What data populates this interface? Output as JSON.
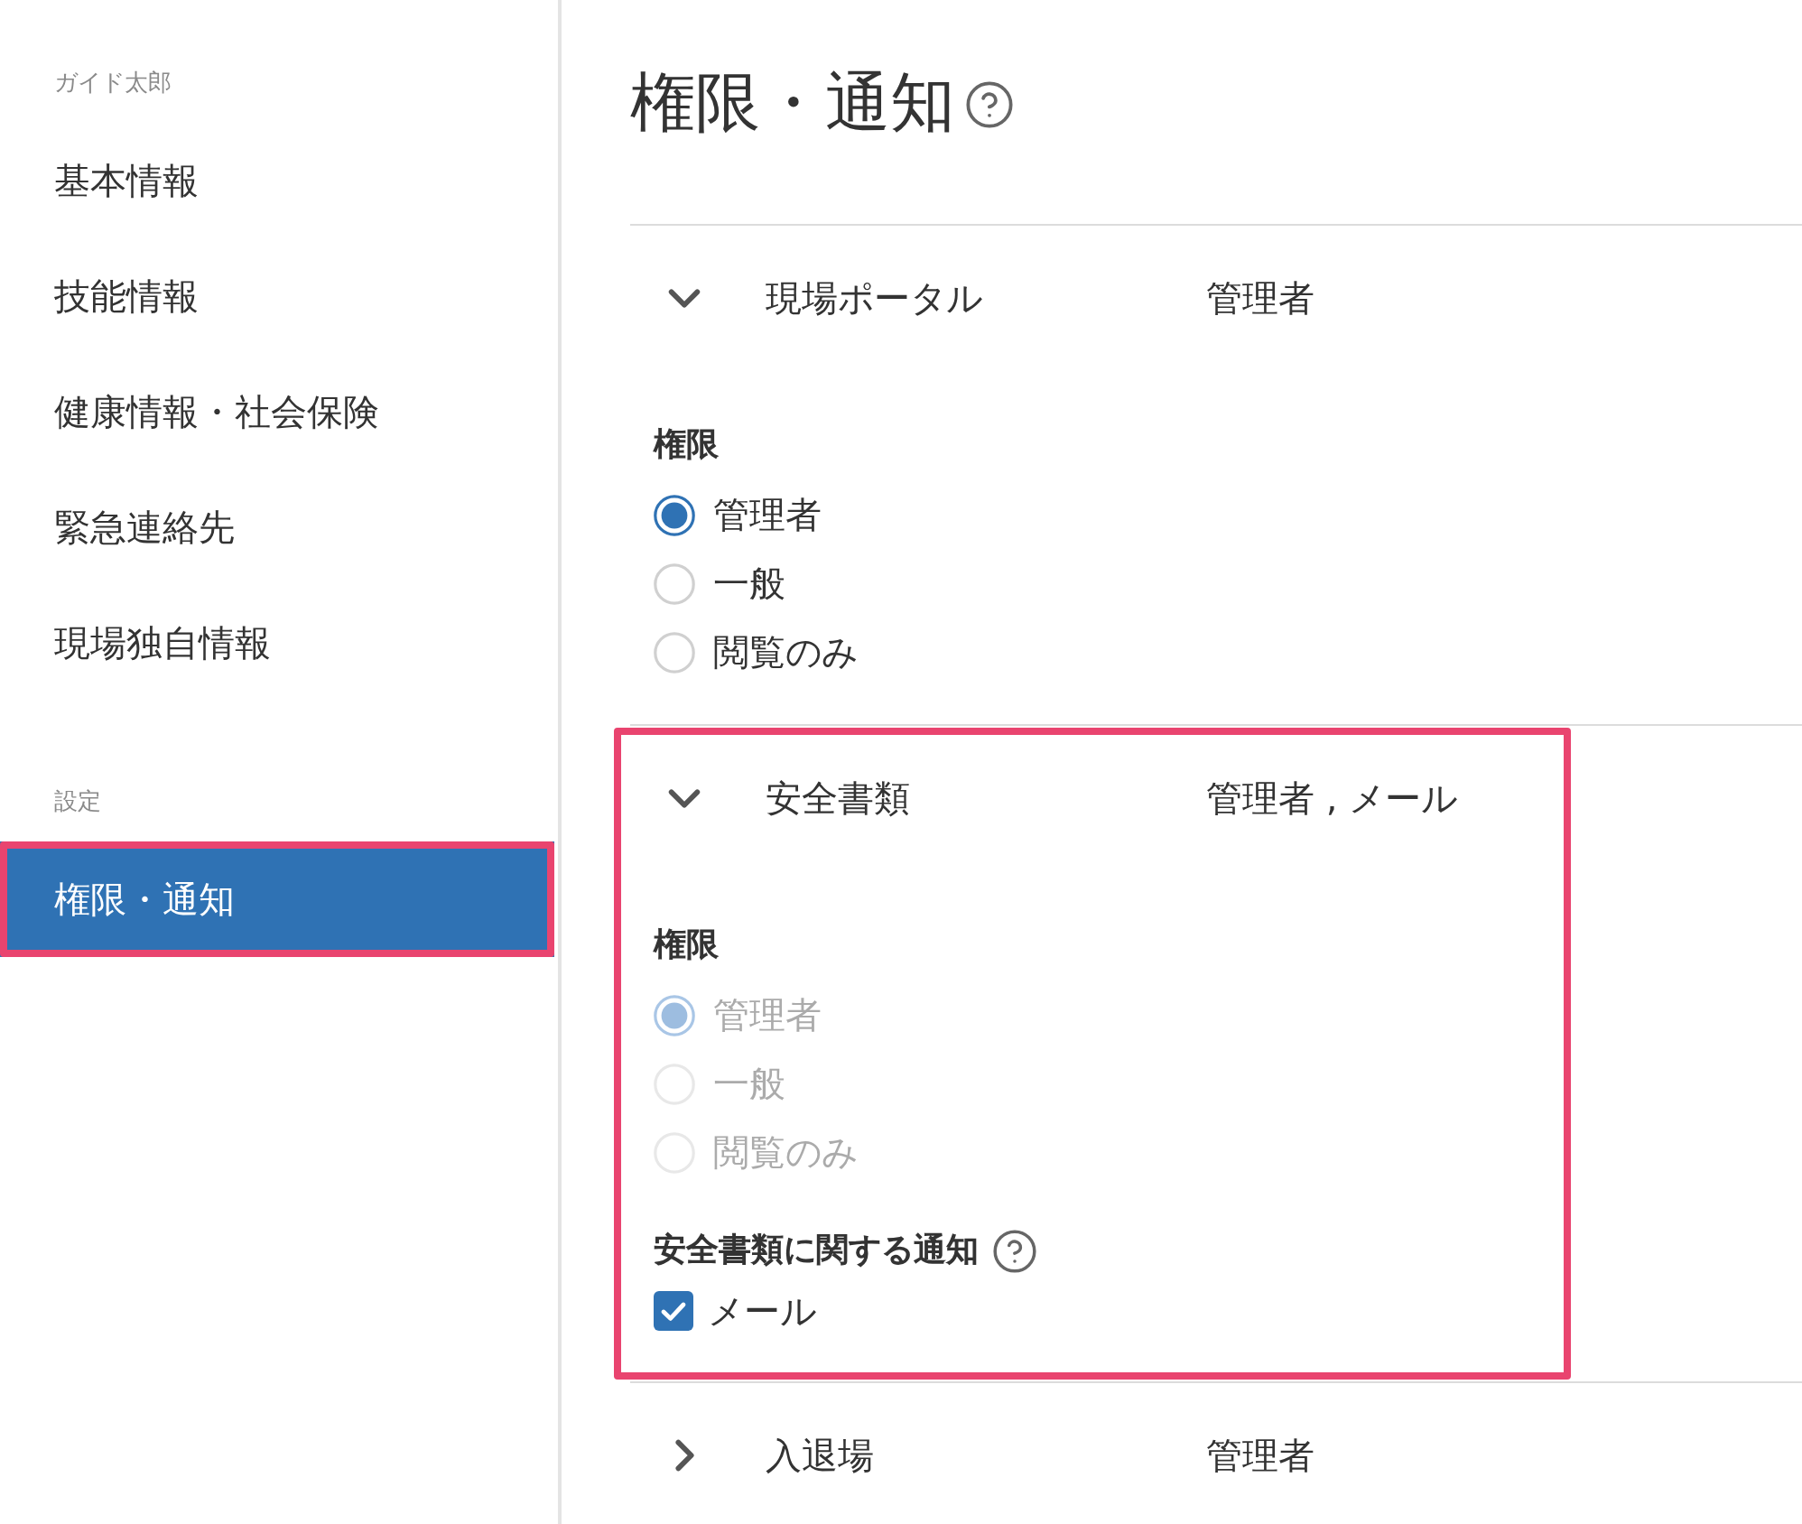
{
  "sidebar": {
    "groups": [
      {
        "heading": "ガイド太郎",
        "items": [
          {
            "label": "基本情報",
            "selected": false,
            "highlighted": false
          },
          {
            "label": "技能情報",
            "selected": false,
            "highlighted": false
          },
          {
            "label": "健康情報・社会保険",
            "selected": false,
            "highlighted": false
          },
          {
            "label": "緊急連絡先",
            "selected": false,
            "highlighted": false
          },
          {
            "label": "現場独自情報",
            "selected": false,
            "highlighted": false
          }
        ]
      },
      {
        "heading": "設定",
        "items": [
          {
            "label": "権限・通知",
            "selected": true,
            "highlighted": true
          }
        ]
      }
    ]
  },
  "page": {
    "title": "権限・通知"
  },
  "sections": [
    {
      "title": "現場ポータル",
      "summary": "管理者",
      "expanded": true,
      "highlighted": false,
      "permission": {
        "label": "権限",
        "options": [
          {
            "label": "管理者",
            "selected": true,
            "disabled": false
          },
          {
            "label": "一般",
            "selected": false,
            "disabled": false
          },
          {
            "label": "閲覧のみ",
            "selected": false,
            "disabled": false
          }
        ]
      }
    },
    {
      "title": "安全書類",
      "summary": "管理者 , メール",
      "expanded": true,
      "highlighted": true,
      "permission": {
        "label": "権限",
        "options": [
          {
            "label": "管理者",
            "selected": true,
            "disabled": true
          },
          {
            "label": "一般",
            "selected": false,
            "disabled": true
          },
          {
            "label": "閲覧のみ",
            "selected": false,
            "disabled": true
          }
        ]
      },
      "notification": {
        "label": "安全書類に関する通知",
        "options": [
          {
            "label": "メール",
            "checked": true
          }
        ]
      }
    },
    {
      "title": "入退場",
      "summary": "管理者",
      "expanded": false,
      "highlighted": false
    }
  ]
}
